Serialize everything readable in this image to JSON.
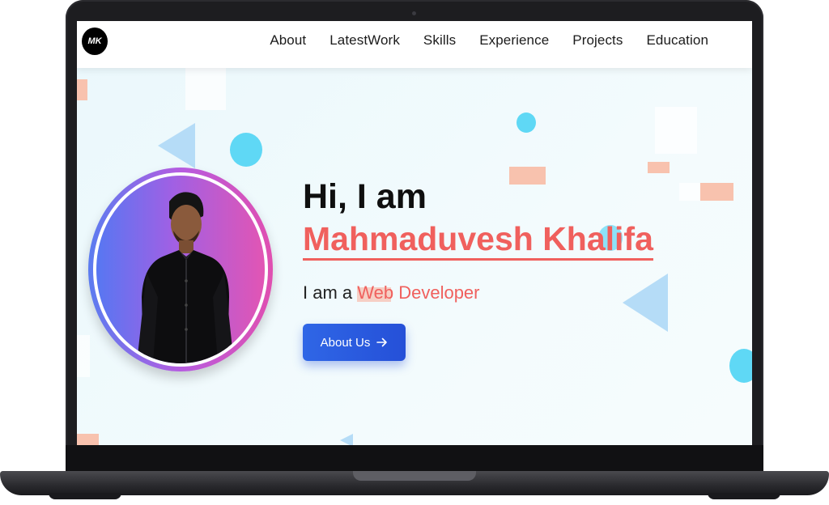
{
  "nav": {
    "logo_text": "MK",
    "items": [
      {
        "label": "About"
      },
      {
        "label": "LatestWork"
      },
      {
        "label": "Skills"
      },
      {
        "label": "Experience"
      },
      {
        "label": "Projects"
      },
      {
        "label": "Education"
      }
    ]
  },
  "hero": {
    "greeting": "Hi, I am",
    "name": "Mahmaduvesh Khalifa",
    "role_prefix": "I am a",
    "role": "Web Developer",
    "cta_label": "About Us",
    "cta_icon": "arrow-right-icon"
  },
  "colors": {
    "accent": "#f0605d",
    "button": "#2f66e6",
    "shape_cyan": "#5fd8f5",
    "shape_salmon": "#f8c2ae",
    "shape_blue": "#b5dcf7"
  }
}
